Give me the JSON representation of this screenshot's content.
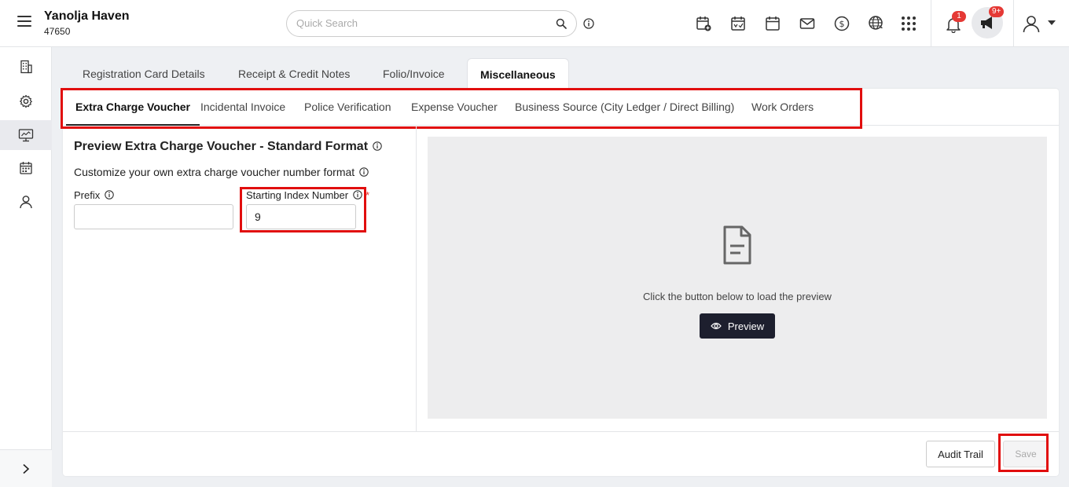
{
  "header": {
    "hotel_name": "Yanolja Haven",
    "hotel_id": "47650",
    "search_placeholder": "Quick Search",
    "notification_count": "1",
    "announcement_count": "9+"
  },
  "toolbar_icons": [
    "new-reservation-icon",
    "event-check-icon",
    "calendar-icon",
    "mail-icon",
    "dollar-icon",
    "globe-icon",
    "apps-grid-icon"
  ],
  "sidebar": {
    "items": [
      "building-icon",
      "settings-gear-icon",
      "monitor-icon",
      "calendar-grid-icon",
      "user-icon"
    ]
  },
  "tabs": [
    "Registration Card Details",
    "Receipt & Credit Notes",
    "Folio/Invoice",
    "Miscellaneous"
  ],
  "subtabs": [
    "Extra Charge Voucher",
    "Incidental Invoice",
    "Police Verification",
    "Expense Voucher",
    "Business Source (City Ledger / Direct Billing)",
    "Work Orders"
  ],
  "form": {
    "title": "Preview Extra Charge Voucher - Standard Format",
    "description": "Customize your own extra charge voucher number format",
    "prefix_label": "Prefix",
    "prefix_value": "",
    "index_label": "Starting Index Number",
    "index_required": "*",
    "index_value": "9"
  },
  "preview": {
    "hint": "Click the button below to load the preview",
    "button_label": "Preview"
  },
  "footer": {
    "audit_label": "Audit Trail",
    "save_label": "Save"
  },
  "colors": {
    "highlight": "#e10e0e",
    "badge": "#e53935",
    "preview_button": "#1d1f2e"
  }
}
